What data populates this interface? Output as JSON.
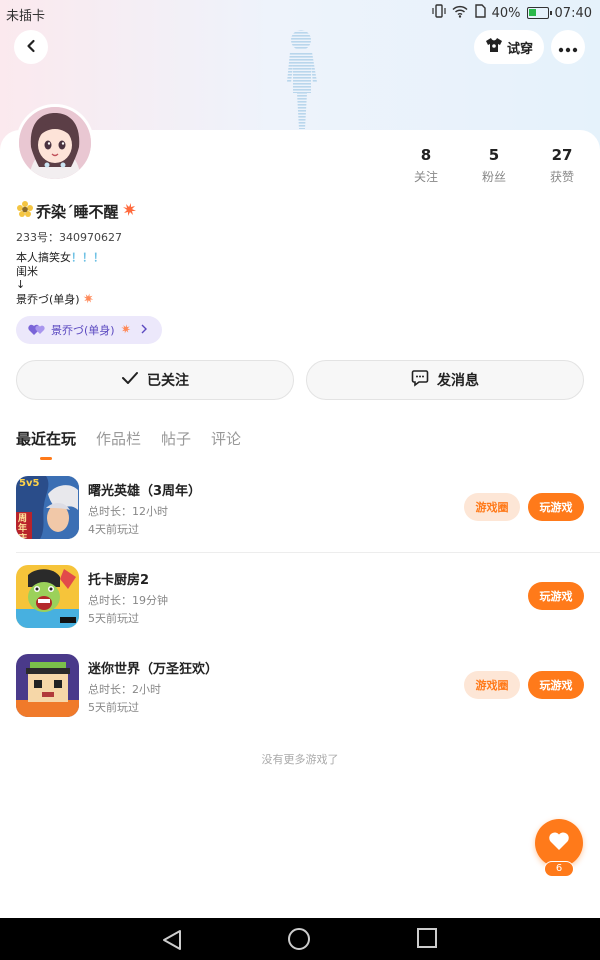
{
  "status_bar": {
    "carrier": "未插卡",
    "battery": "40%",
    "battery_level": 0.4,
    "time": "07:40"
  },
  "header": {
    "try_on_label": "试穿"
  },
  "profile": {
    "stats": [
      {
        "value": "8",
        "label": "关注"
      },
      {
        "value": "5",
        "label": "粉丝"
      },
      {
        "value": "27",
        "label": "获赞"
      }
    ],
    "nickname": "乔染ˊ睡不醒",
    "uid": "233号：340970627",
    "bio_line1_text": "本人搞笑女",
    "bio_line1_marks": "！！！",
    "bio_line2": "闺米",
    "bio_line3": "↓",
    "bio_line4": "景乔づ(单身)",
    "cp_tag": "景乔づ(单身)"
  },
  "actions": {
    "follow_label": "已关注",
    "message_label": "发消息"
  },
  "tabs": [
    "最近在玩",
    "作品栏",
    "帖子",
    "评论"
  ],
  "games": [
    {
      "name": "曙光英雄（3周年）",
      "duration": "总时长：12小时",
      "last_played": "4天前玩过",
      "circle_label": "游戏圈",
      "play_label": "玩游戏",
      "icon_text": "5v5",
      "icon_badge": "周年庆"
    },
    {
      "name": "托卡厨房2",
      "duration": "总时长：19分钟",
      "last_played": "5天前玩过",
      "play_label": "玩游戏"
    },
    {
      "name": "迷你世界（万圣狂欢）",
      "duration": "总时长：2小时",
      "last_played": "5天前玩过",
      "circle_label": "游戏圈",
      "play_label": "玩游戏"
    }
  ],
  "list_footer": "没有更多游戏了",
  "fab": {
    "count": "6"
  },
  "colors": {
    "accent": "#ff7a1a",
    "accent_soft": "#fde6d6",
    "tag_bg": "#ece8fb",
    "tag_text": "#5b49c0"
  }
}
